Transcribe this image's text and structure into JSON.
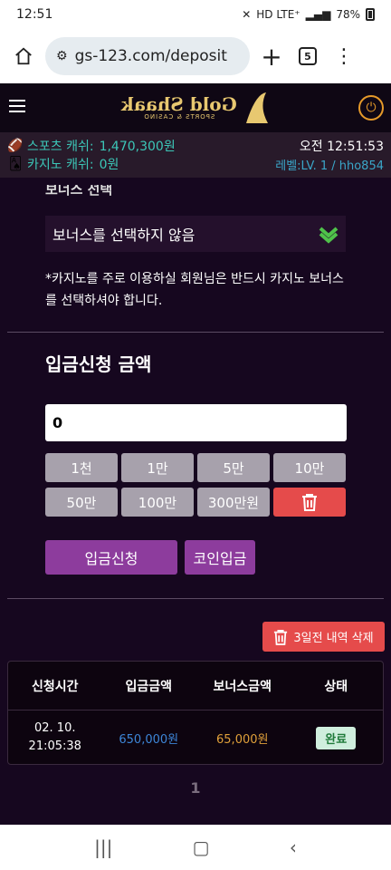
{
  "status_bar": {
    "time": "12:51",
    "indicators": "HD LTE⁺",
    "battery": "78%"
  },
  "browser": {
    "url": "gs-123.com/deposit",
    "tab_count": "5"
  },
  "site": {
    "logo_name": "Gold Shaak",
    "logo_sub": "SPORTS & CASINO"
  },
  "info": {
    "sports_label": "스포츠 캐쉬:",
    "sports_value": "1,470,300원",
    "casino_label": "카지노 캐쉬:",
    "casino_value": "0원",
    "clock": "오전 12:51:53",
    "level": "레벨:LV. 1 / hho854"
  },
  "bonus": {
    "heading": "보너스 선택",
    "selected": "보너스를 선택하지 않음",
    "notice": "*카지노를 주로 이용하실 회원님은 반드시 카지노 보너스를 선택하셔야 합니다."
  },
  "deposit": {
    "title": "입금신청 금액",
    "amount_value": "0",
    "amount_buttons": [
      "1천",
      "1만",
      "5만",
      "10만",
      "50만",
      "100만",
      "300만원"
    ],
    "submit_label": "입금신청",
    "coin_label": "코인입금"
  },
  "history": {
    "delete_label": "3일전 내역 삭제",
    "headers": [
      "신청시간",
      "입금금액",
      "보너스금액",
      "상태"
    ],
    "rows": [
      {
        "time_line1": "02. 10.",
        "time_line2": "21:05:38",
        "deposit": "650,000원",
        "bonus": "65,000원",
        "status": "완료"
      }
    ],
    "page": "1"
  },
  "colors": {
    "accent_purple": "#8d3c9d",
    "danger_red": "#e54b4b",
    "teal": "#3cc7b8",
    "background": "#16071f"
  }
}
